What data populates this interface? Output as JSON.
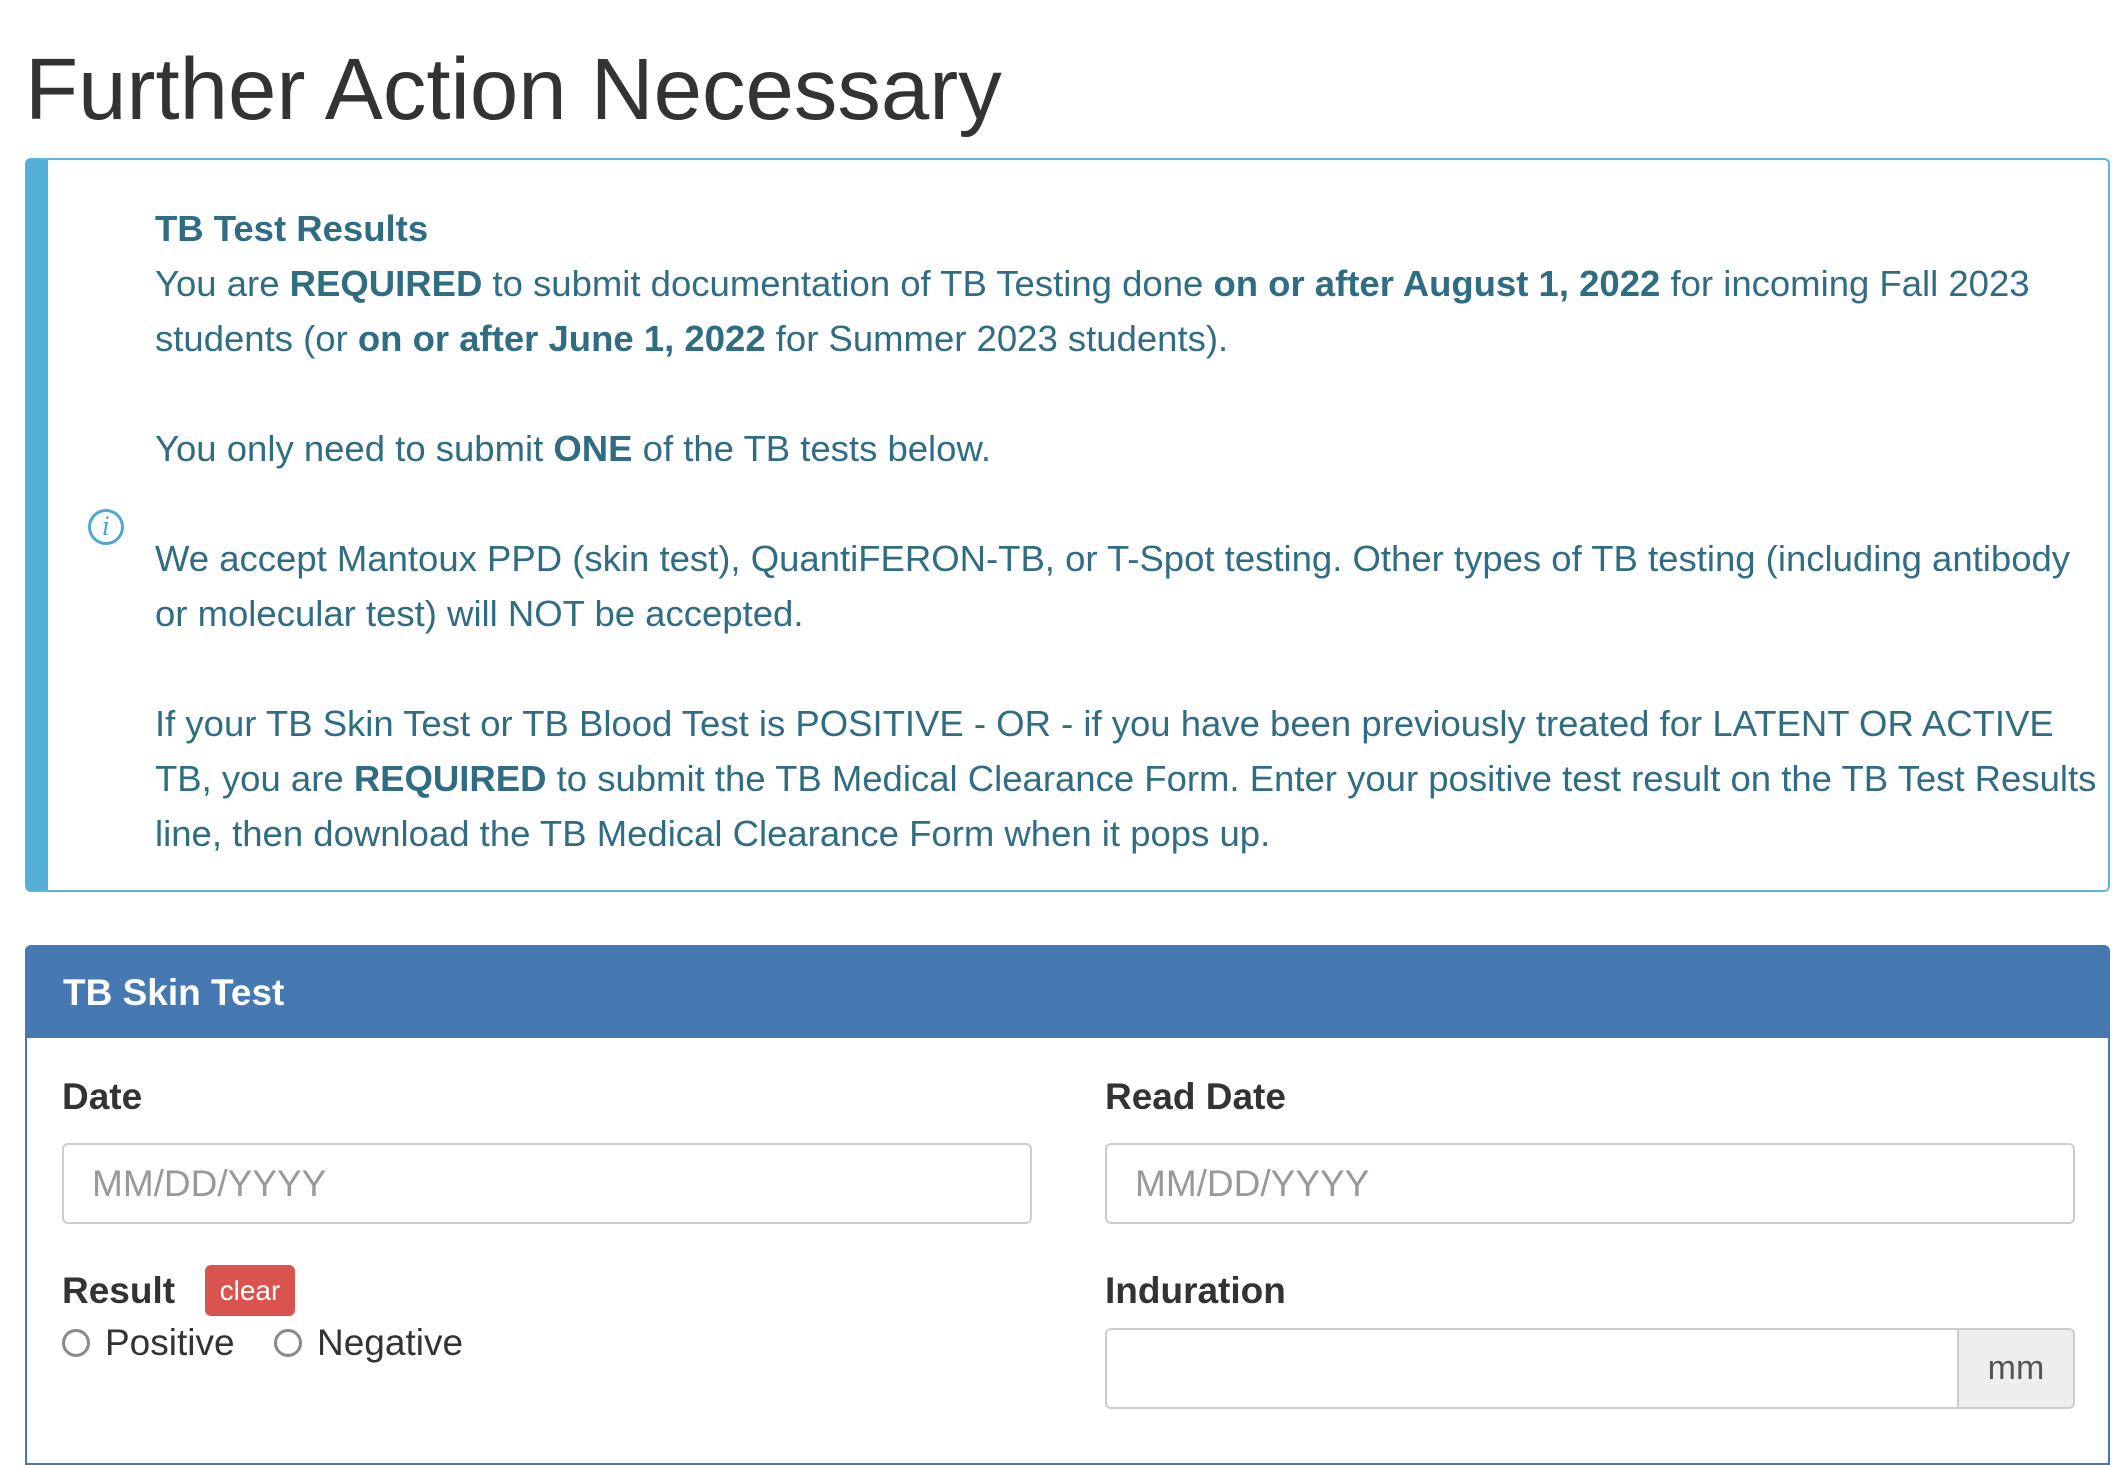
{
  "page": {
    "title": "Further Action Necessary"
  },
  "alert": {
    "icon": "info-icon",
    "heading": "TB Test Results",
    "p1": {
      "t1": "You are ",
      "b1": "REQUIRED",
      "t2": " to submit documentation of TB Testing done ",
      "b2": "on or after August 1, 2022",
      "t3": " for incoming Fall 2023 students (or ",
      "b3": "on or after June 1, 2022",
      "t4": " for Summer 2023 students)."
    },
    "p2": {
      "t1": "You only need to submit ",
      "b1": "ONE",
      "t2": " of the TB tests below."
    },
    "p3": "We accept Mantoux PPD (skin test), QuantiFERON-TB, or T-Spot testing. Other types of TB testing (including antibody or molecular test) will NOT be accepted.",
    "p4": {
      "t1": "If your TB Skin Test or TB Blood Test is POSITIVE - OR - if you have been previously treated for LATENT OR ACTIVE TB, you are ",
      "b1": "REQUIRED",
      "t2": " to submit the TB Medical Clearance Form. Enter your positive test result on the TB Test Results line, then download the TB Medical Clearance Form when it pops up."
    }
  },
  "panel": {
    "heading": "TB Skin Test",
    "date": {
      "label": "Date",
      "placeholder": "MM/DD/YYYY",
      "value": ""
    },
    "read_date": {
      "label": "Read Date",
      "placeholder": "MM/DD/YYYY",
      "value": ""
    },
    "result": {
      "label": "Result",
      "clear_label": "clear",
      "options": [
        "Positive",
        "Negative"
      ],
      "selected": null
    },
    "induration": {
      "label": "Induration",
      "value": "",
      "unit": "mm"
    }
  },
  "colors": {
    "alert_text": "#306d82",
    "alert_border": "#53afd6",
    "panel_header": "#4679b2",
    "clear_badge": "#d9534f"
  }
}
